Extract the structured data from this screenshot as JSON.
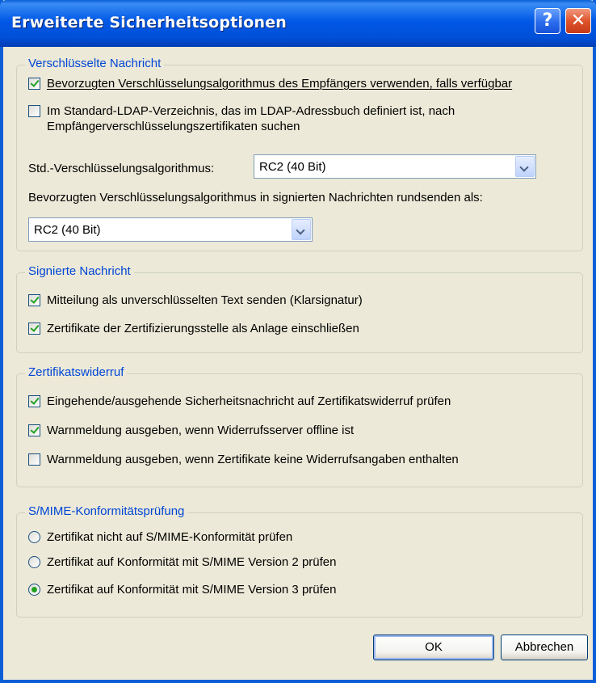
{
  "window": {
    "title": "Erweiterte Sicherheitsoptionen"
  },
  "titlebar": {
    "help_label": "?",
    "close_label": "✕"
  },
  "encrypted": {
    "title": "Verschlüsselte Nachricht",
    "opt1_label": "Bevorzugten Verschlüsselungsalgorithmus des Empfängers verwenden, falls verfügbar",
    "opt1_checked": true,
    "opt2_label_line1": "Im Standard-LDAP-Verzeichnis, das im LDAP-Adressbuch definiert ist, nach",
    "opt2_label_line2": "Empfängerverschlüsselungszertifikaten suchen",
    "opt2_checked": false,
    "std_algo_label": "Std.-Verschlüsselungsalgorithmus:",
    "std_algo_value": "RC2 (40 Bit)",
    "broadcast_label": "Bevorzugten Verschlüsselungsalgorithmus in signierten Nachrichten rundsenden als:",
    "broadcast_value": "RC2 (40 Bit)"
  },
  "signed": {
    "title": "Signierte Nachricht",
    "opt1_label": "Mitteilung als unverschlüsselten Text senden (Klarsignatur)",
    "opt1_checked": true,
    "opt2_label": "Zertifikate der Zertifizierungsstelle als Anlage einschließen",
    "opt2_checked": true
  },
  "revocation": {
    "title": "Zertifikatswiderruf",
    "opt1_label": "Eingehende/ausgehende Sicherheitsnachricht auf Zertifikatswiderruf prüfen",
    "opt1_checked": true,
    "opt2_label": "Warnmeldung ausgeben, wenn Widerrufsserver offline ist",
    "opt2_checked": true,
    "opt3_label": "Warnmeldung ausgeben, wenn Zertifikate keine Widerrufsangaben enthalten",
    "opt3_checked": false
  },
  "smime": {
    "title": "S/MIME-Konformitätsprüfung",
    "opt1_label": "Zertifikat nicht auf S/MIME-Konformität prüfen",
    "opt2_label": "Zertifikat auf Konformität mit S/MIME Version 2 prüfen",
    "opt3_label": "Zertifikat auf Konformität mit S/MIME Version 3 prüfen",
    "selected": 3
  },
  "buttons": {
    "ok_label": "OK",
    "cancel_label": "Abbrechen"
  },
  "colors": {
    "titlebar": "#0058e6",
    "group_title": "#0046d5",
    "dialog_bg": "#ece9d8",
    "check": "#21a121"
  }
}
